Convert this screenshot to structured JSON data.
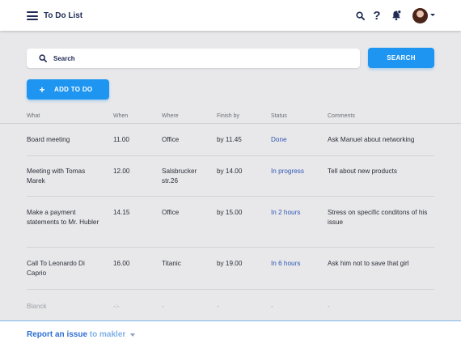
{
  "header": {
    "title": "To Do List",
    "help_glyph": "?",
    "icons": [
      "menu-icon",
      "search-icon",
      "help-icon",
      "bell-icon",
      "avatar",
      "chevron-down-icon"
    ]
  },
  "search": {
    "placeholder": "Search",
    "button_label": "SEARCH"
  },
  "add_button": {
    "glyph": "+",
    "label": "ADD TO DO"
  },
  "table": {
    "columns": [
      "What",
      "When",
      "Where",
      "Finish by",
      "Status",
      "Comments"
    ],
    "rows": [
      {
        "what": "Board meeting",
        "when": "11.00",
        "where": "Office",
        "finish": "by 11.45",
        "status": "Done",
        "comments": "Ask Manuel about networking"
      },
      {
        "what": "Meeting with Tomas Marek",
        "when": "12.00",
        "where": "Salsbrucker str.26",
        "finish": "by 14.00",
        "status": "In progress",
        "comments": "Tell about new products"
      },
      {
        "what": "Make a payment statements to Mr. Hubler",
        "when": "14.15",
        "where": "Office",
        "finish": "by 15.00",
        "status": "In 2 hours",
        "comments": "Stress on specific conditons of his issue"
      },
      {
        "what": "Call To Leonardo Di Caprio",
        "when": "16.00",
        "where": "Titanic",
        "finish": "by 19.00",
        "status": "In 6 hours",
        "comments": "Ask him not to save that girl"
      },
      {
        "what": "Blanck",
        "when": "-:-",
        "where": "-",
        "finish": "-",
        "status": "-",
        "comments": "-"
      }
    ]
  },
  "footer": {
    "link_main": "Report an issue",
    "link_muted": " to makler"
  },
  "colors": {
    "accent": "#1e95f0",
    "navy": "#1f2a55",
    "status_text": "#2f57b5",
    "background": "#e8e8ea"
  }
}
